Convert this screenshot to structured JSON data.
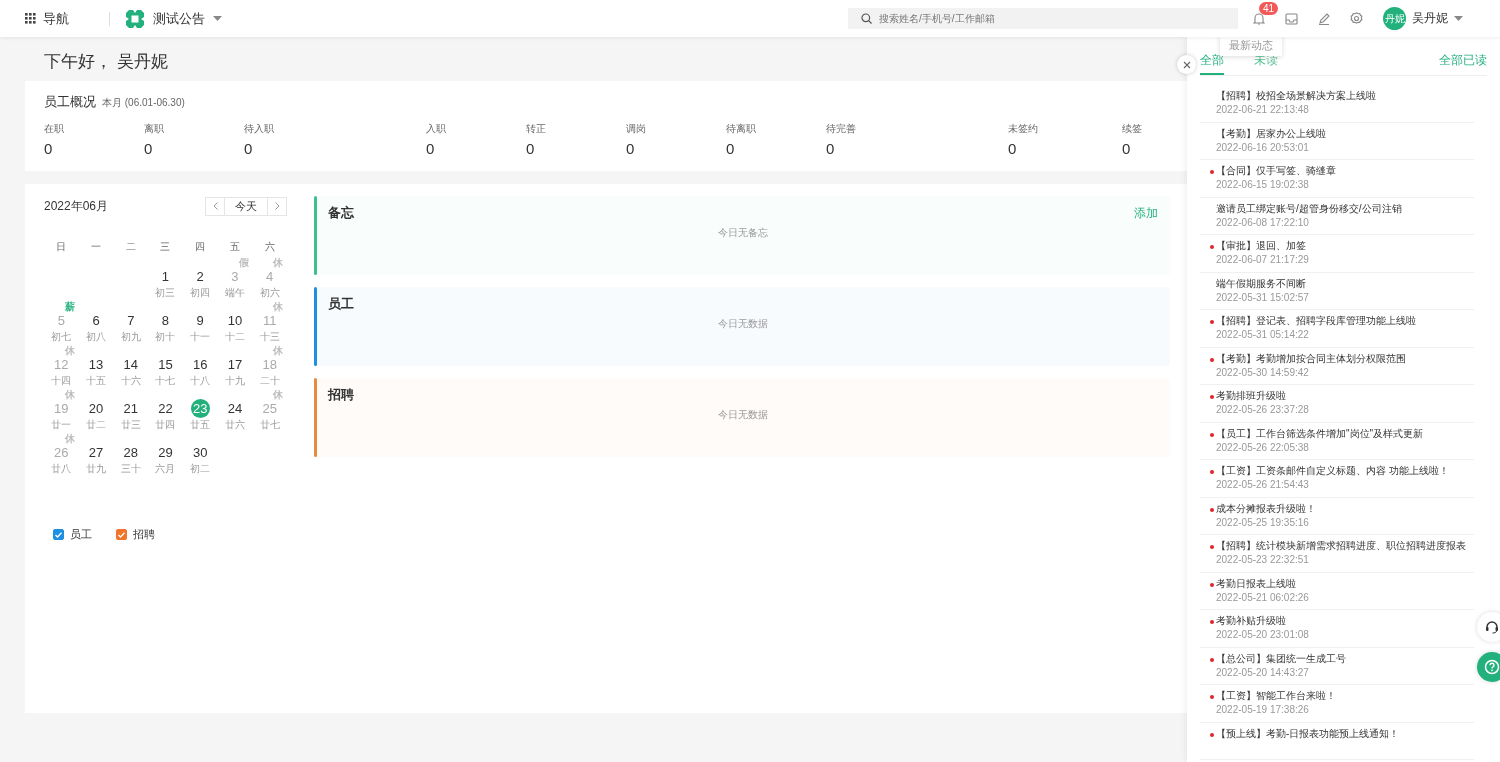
{
  "topbar": {
    "nav_label": "导航",
    "org_name": "测试公告",
    "search": {
      "placeholder": "搜索姓名/手机号/工作邮箱"
    },
    "notification_count": "41",
    "user": {
      "avatar_text": "丹妮",
      "name": "吴丹妮"
    }
  },
  "greeting": "下午好， 吴丹妮",
  "overview": {
    "title": "员工概况",
    "period": "本月 (06.01-06.30)",
    "groups": [
      [
        {
          "label": "在职",
          "value": "0"
        },
        {
          "label": "离职",
          "value": "0"
        },
        {
          "label": "待入职",
          "value": "0"
        }
      ],
      [
        {
          "label": "入职",
          "value": "0"
        },
        {
          "label": "转正",
          "value": "0"
        },
        {
          "label": "调岗",
          "value": "0"
        },
        {
          "label": "待离职",
          "value": "0"
        },
        {
          "label": "待完善",
          "value": "0"
        }
      ],
      [
        {
          "label": "未签约",
          "value": "0"
        },
        {
          "label": "续签",
          "value": "0"
        }
      ]
    ]
  },
  "calendar": {
    "month": "2022年06月",
    "today_button": "今天",
    "weekdays": [
      "日",
      "一",
      "二",
      "三",
      "四",
      "五",
      "六"
    ],
    "weeks": [
      [
        {
          "kind": "blank"
        },
        {
          "kind": "blank"
        },
        {
          "kind": "blank"
        },
        {
          "day": "1",
          "lunar": "初三",
          "muted": false,
          "selected": false
        },
        {
          "day": "2",
          "lunar": "初四",
          "muted": false,
          "selected": false
        },
        {
          "day": "3",
          "lunar": "端午",
          "muted": true,
          "selected": false,
          "tag": {
            "text": "假",
            "color": "#bbbbbb"
          }
        },
        {
          "day": "4",
          "lunar": "初六",
          "muted": true,
          "selected": false,
          "tag": {
            "text": "休",
            "color": "#bbbbbb"
          }
        }
      ],
      [
        {
          "day": "5",
          "lunar": "初七",
          "muted": true,
          "selected": false,
          "tag": {
            "text": "薪",
            "color": "#22b07d"
          }
        },
        {
          "day": "6",
          "lunar": "初八",
          "muted": false,
          "selected": false
        },
        {
          "day": "7",
          "lunar": "初九",
          "muted": false,
          "selected": false
        },
        {
          "day": "8",
          "lunar": "初十",
          "muted": false,
          "selected": false
        },
        {
          "day": "9",
          "lunar": "十一",
          "muted": false,
          "selected": false
        },
        {
          "day": "10",
          "lunar": "十二",
          "muted": false,
          "selected": false
        },
        {
          "day": "11",
          "lunar": "十三",
          "muted": true,
          "selected": false,
          "tag": {
            "text": "休",
            "color": "#bbbbbb"
          }
        }
      ],
      [
        {
          "day": "12",
          "lunar": "十四",
          "muted": true,
          "selected": false,
          "tag": {
            "text": "休",
            "color": "#bbbbbb"
          }
        },
        {
          "day": "13",
          "lunar": "十五",
          "muted": false,
          "selected": false
        },
        {
          "day": "14",
          "lunar": "十六",
          "muted": false,
          "selected": false
        },
        {
          "day": "15",
          "lunar": "十七",
          "muted": false,
          "selected": false
        },
        {
          "day": "16",
          "lunar": "十八",
          "muted": false,
          "selected": false
        },
        {
          "day": "17",
          "lunar": "十九",
          "muted": false,
          "selected": false
        },
        {
          "day": "18",
          "lunar": "二十",
          "muted": true,
          "selected": false,
          "tag": {
            "text": "休",
            "color": "#bbbbbb"
          }
        }
      ],
      [
        {
          "day": "19",
          "lunar": "廿一",
          "muted": true,
          "selected": false,
          "tag": {
            "text": "休",
            "color": "#bbbbbb"
          }
        },
        {
          "day": "20",
          "lunar": "廿二",
          "muted": false,
          "selected": false
        },
        {
          "day": "21",
          "lunar": "廿三",
          "muted": false,
          "selected": false
        },
        {
          "day": "22",
          "lunar": "廿四",
          "muted": false,
          "selected": false
        },
        {
          "day": "23",
          "lunar": "廿五",
          "muted": false,
          "selected": true
        },
        {
          "day": "24",
          "lunar": "廿六",
          "muted": false,
          "selected": false
        },
        {
          "day": "25",
          "lunar": "廿七",
          "muted": true,
          "selected": false,
          "tag": {
            "text": "休",
            "color": "#bbbbbb"
          }
        }
      ],
      [
        {
          "day": "26",
          "lunar": "廿八",
          "muted": true,
          "selected": false,
          "tag": {
            "text": "休",
            "color": "#bbbbbb"
          }
        },
        {
          "day": "27",
          "lunar": "廿九",
          "muted": false,
          "selected": false
        },
        {
          "day": "28",
          "lunar": "三十",
          "muted": false,
          "selected": false
        },
        {
          "day": "29",
          "lunar": "六月",
          "muted": false,
          "selected": false
        },
        {
          "day": "30",
          "lunar": "初二",
          "muted": false,
          "selected": false
        }
      ]
    ],
    "legend": [
      {
        "label": "员工",
        "checked": true,
        "color": "#1e8fe1"
      },
      {
        "label": "招聘",
        "checked": true,
        "color": "#f0742a"
      }
    ]
  },
  "panels": [
    {
      "title": "备忘",
      "color": "#3cc08e",
      "action": "添加",
      "empty_text": "今日无备忘"
    },
    {
      "title": "员工",
      "color": "#1e8fe1",
      "empty_text": "今日无数据"
    },
    {
      "title": "招聘",
      "color": "#e8893e",
      "empty_text": "今日无数据"
    }
  ],
  "notifications": {
    "tooltip": "最新动态",
    "tabs": [
      {
        "label": "全部",
        "selected": true
      },
      {
        "label": "未读",
        "selected": false
      }
    ],
    "mark_all_read": "全部已读",
    "items": [
      {
        "title": "【招聘】校招全场景解决方案上线啦",
        "time": "2022-06-21 22:13:48",
        "unread": false
      },
      {
        "title": "【考勤】居家办公上线啦",
        "time": "2022-06-16 20:53:01",
        "unread": false
      },
      {
        "title": "【合同】仅手写签、骑缝章",
        "time": "2022-06-15 19:02:38",
        "unread": true
      },
      {
        "title": "邀请员工绑定账号/超管身份移交/公司注销",
        "time": "2022-06-08 17:22:10",
        "unread": false
      },
      {
        "title": "【审批】退回、加签",
        "time": "2022-06-07 21:17:29",
        "unread": true
      },
      {
        "title": "端午假期服务不间断",
        "time": "2022-05-31 15:02:57",
        "unread": false
      },
      {
        "title": "【招聘】登记表、招聘字段库管理功能上线啦",
        "time": "2022-05-31 05:14:22",
        "unread": true
      },
      {
        "title": "【考勤】考勤增加按合同主体划分权限范围",
        "time": "2022-05-30 14:59:42",
        "unread": true
      },
      {
        "title": "考勤排班升级啦",
        "time": "2022-05-26 23:37:28",
        "unread": true
      },
      {
        "title": "【员工】工作台筛选条件增加\"岗位\"及样式更新",
        "time": "2022-05-26 22:05:38",
        "unread": true
      },
      {
        "title": "【工资】工资条邮件自定义标题、内容 功能上线啦！",
        "time": "2022-05-26 21:54:43",
        "unread": true
      },
      {
        "title": "成本分摊报表升级啦！",
        "time": "2022-05-25 19:35:16",
        "unread": true
      },
      {
        "title": "【招聘】统计模块新增需求招聘进度、职位招聘进度报表",
        "time": "2022-05-23 22:32:51",
        "unread": true
      },
      {
        "title": "考勤日报表上线啦",
        "time": "2022-05-21 06:02:26",
        "unread": true
      },
      {
        "title": "考勤补贴升级啦",
        "time": "2022-05-20 23:01:08",
        "unread": true
      },
      {
        "title": "【总公司】集团统一生成工号",
        "time": "2022-05-20 14:43:27",
        "unread": true
      },
      {
        "title": "【工资】智能工作台来啦！",
        "time": "2022-05-19 17:38:26",
        "unread": true
      },
      {
        "title": "【预上线】考勤-日报表功能预上线通知！",
        "unread": true
      }
    ]
  }
}
